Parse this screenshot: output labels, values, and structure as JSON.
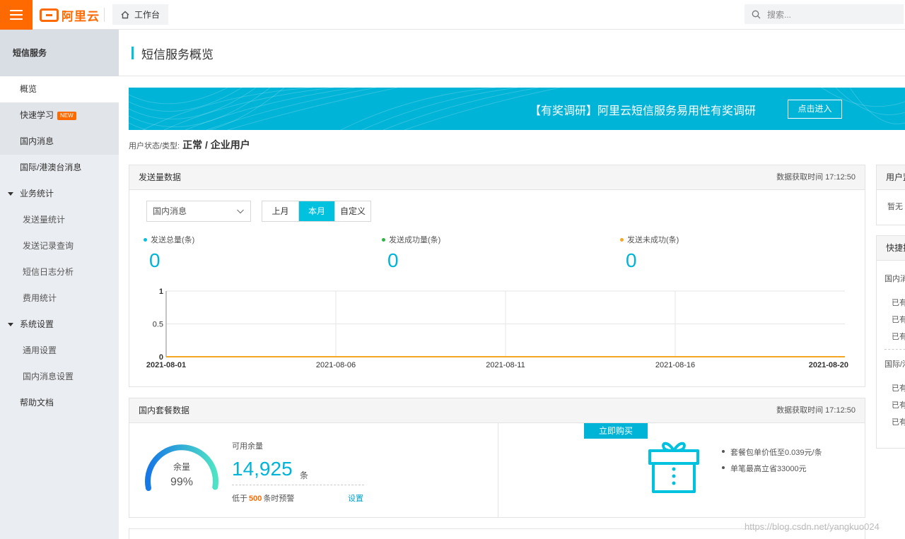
{
  "topbar": {
    "logo_text": "阿里云",
    "workbench_label": "工作台",
    "search_placeholder": "搜索..."
  },
  "sidebar": {
    "header": "短信服务",
    "items": [
      {
        "label": "概览"
      },
      {
        "label": "快速学习",
        "badge": "NEW"
      },
      {
        "label": "国内消息"
      },
      {
        "label": "国际/港澳台消息"
      },
      {
        "label": "业务统计"
      },
      {
        "label": "发送量统计"
      },
      {
        "label": "发送记录查询"
      },
      {
        "label": "短信日志分析"
      },
      {
        "label": "费用统计"
      },
      {
        "label": "系统设置"
      },
      {
        "label": "通用设置"
      },
      {
        "label": "国内消息设置"
      },
      {
        "label": "帮助文档"
      }
    ]
  },
  "page": {
    "title": "短信服务概览",
    "banner_text": "【有奖调研】阿里云短信服务易用性有奖调研",
    "banner_button": "点击进入",
    "user_status_label": "用户状态/类型:",
    "user_status_value": "正常 / 企业用户"
  },
  "send_card": {
    "title": "发送量数据",
    "time": "数据获取时间 17:12:50",
    "select_value": "国内消息",
    "segments": [
      "上月",
      "本月",
      "自定义"
    ],
    "active_segment": "本月",
    "metrics": [
      {
        "label": "发送总量(条)",
        "value": "0",
        "color": "#00c1de"
      },
      {
        "label": "发送成功量(条)",
        "value": "0",
        "color": "#2fb344"
      },
      {
        "label": "发送未成功(条)",
        "value": "0",
        "color": "#f5a623"
      }
    ]
  },
  "chart_data": {
    "type": "line",
    "x": [
      "2021-08-01",
      "2021-08-06",
      "2021-08-11",
      "2021-08-16",
      "2021-08-20"
    ],
    "series": [
      {
        "values": [
          0,
          0,
          0,
          0,
          0
        ],
        "color": "#f5a623"
      }
    ],
    "ylim": [
      0,
      1
    ],
    "yticks": [
      "1",
      "0.5",
      "0"
    ],
    "grid": true
  },
  "package_card": {
    "title": "国内套餐数据",
    "time": "数据获取时间 17:12:50",
    "gauge_label": "余量",
    "gauge_percent": "99%",
    "gauge_fraction": 0.99,
    "available_label": "可用余量",
    "available_value": "14,925",
    "available_unit": "条",
    "warn_prefix": "低于",
    "warn_num": "500",
    "warn_suffix": "条时预警",
    "setting_link": "设置",
    "buy_button": "立即购买",
    "bullets": [
      "套餐包单价低至0.039元/条",
      "单笔最高立省33000元"
    ]
  },
  "right_col": {
    "card1_head": "用户监",
    "card1_text": "暂无",
    "card2_head": "快捷操",
    "card2_sec1": "国内消",
    "card2_lines1": [
      "已有",
      "已有",
      "已有"
    ],
    "card2_sec2": "国际/港",
    "card2_lines2": [
      "已有",
      "已有",
      "已有"
    ]
  },
  "watermark": "https://blog.csdn.net/yangkuo024"
}
